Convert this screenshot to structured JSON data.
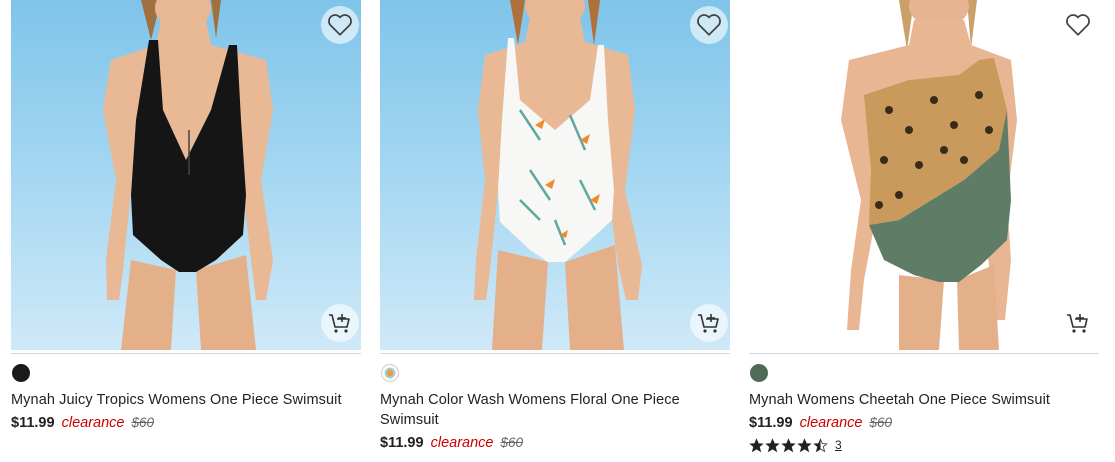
{
  "products": [
    {
      "title": "Mynah Juicy Tropics Womens One Piece Swimsuit",
      "price": "$11.99",
      "tag": "clearance",
      "original_price": "$60",
      "swatch_color": "#1a1a1a",
      "wishlist_icon": "heart-outline-icon",
      "cart_icon": "add-to-cart-icon"
    },
    {
      "title": "Mynah Color Wash Womens Floral One Piece Swimsuit",
      "price": "$11.99",
      "tag": "clearance",
      "original_price": "$60",
      "swatch_color": "floral-print",
      "wishlist_icon": "heart-outline-icon",
      "cart_icon": "add-to-cart-icon"
    },
    {
      "title": "Mynah Womens Cheetah One Piece Swimsuit",
      "price": "$11.99",
      "tag": "clearance",
      "original_price": "$60",
      "swatch_color": "#4f6b58",
      "rating": 4.5,
      "rating_count": "3",
      "wishlist_icon": "heart-outline-icon",
      "cart_icon": "add-to-cart-icon"
    }
  ],
  "colors": {
    "clearance": "#cc0000",
    "price": "#222222",
    "divider": "#d8d8d8"
  }
}
